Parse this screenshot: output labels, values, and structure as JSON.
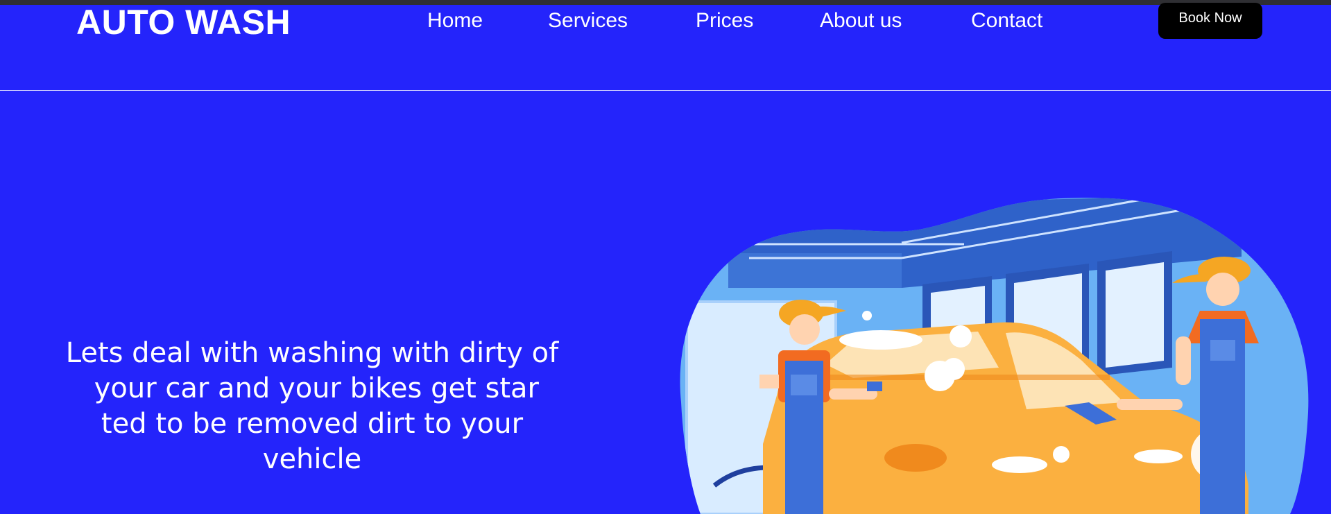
{
  "header": {
    "logo": "AUTO WASH",
    "nav": [
      {
        "label": "Home"
      },
      {
        "label": "Services"
      },
      {
        "label": "Prices"
      },
      {
        "label": "About us"
      },
      {
        "label": "Contact"
      }
    ],
    "book_label": "Book Now"
  },
  "hero": {
    "lines": [
      "Lets deal with washing with dirty of",
      " your car and your bikes get star",
      "ted to be removed dirt to your",
      "vehicle"
    ]
  },
  "colors": {
    "page_background": "#2424fb",
    "button_background": "#000000",
    "text": "#ffffff",
    "worker_cap": "#f5a623",
    "worker_shirt": "#f26b21",
    "worker_overalls": "#3d6fd8",
    "car": "#fbb040"
  },
  "icons": [
    "car-wash-illustration"
  ]
}
